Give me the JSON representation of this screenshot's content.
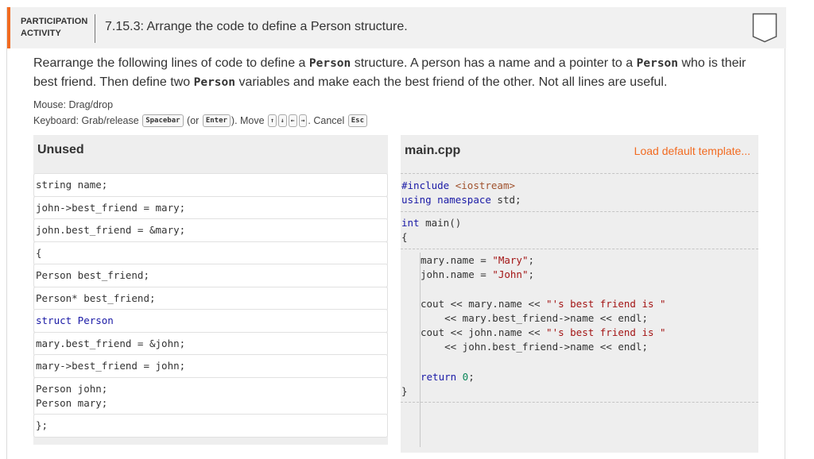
{
  "header": {
    "activity_type_line1": "PARTICIPATION",
    "activity_type_line2": "ACTIVITY",
    "title": "7.15.3: Arrange the code to define a Person structure.",
    "bookmark_icon": "bookmark-icon"
  },
  "instructions": {
    "part1": "Rearrange the following lines of code to define a ",
    "code1": "Person",
    "part2": " structure. A person has a name and a pointer to a ",
    "code2": "Person",
    "part3": " who is their best friend. Then define two ",
    "code3": "Person",
    "part4": " variables and make each the best friend of the other. Not all lines are useful."
  },
  "controls": {
    "mouse": "Mouse: Drag/drop",
    "keyboard_prefix": "Keyboard: Grab/release",
    "spacebar": "Spacebar",
    "or_open": "(or",
    "enter": "Enter",
    "move_text": "). Move",
    "up": "↑",
    "down": "↓",
    "left": "←",
    "right": "→",
    "cancel_text": ". Cancel",
    "esc": "Esc"
  },
  "unused": {
    "title": "Unused",
    "blocks": [
      "string name;",
      "john->best_friend = mary;",
      "john.best_friend = &mary;",
      "{",
      "Person best_friend;",
      "Person* best_friend;",
      "struct Person",
      "mary.best_friend = &john;",
      "mary->best_friend = john;",
      "Person john;\nPerson mary;",
      "};"
    ]
  },
  "main": {
    "title": "main.cpp",
    "load_default": "Load default template...",
    "include_directive": "#include",
    "include_file": "<iostream>",
    "using_kw": "using",
    "namespace_kw": "namespace",
    "std_text": " std;",
    "int_kw": "int",
    "main_fn": " main",
    "main_parens": "()",
    "open_brace": "{",
    "mary_name": "mary.name = ",
    "mary_str": "\"Mary\"",
    "john_name": "john.name = ",
    "john_str": "\"John\"",
    "semicolon": ";",
    "cout1a": "cout << mary.name << ",
    "cout1b": "\"'s best friend is \"",
    "cout1c": "    << mary.best_friend->name << endl;",
    "cout2a": "cout << john.name << ",
    "cout2b": "\"'s best friend is \"",
    "cout2c": "    << john.best_friend->name << endl;",
    "return_kw": "return",
    "return_val": " 0",
    "close_brace": "}"
  }
}
